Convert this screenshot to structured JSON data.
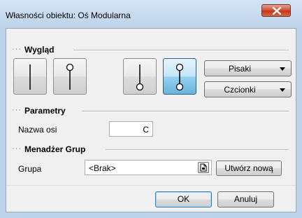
{
  "window": {
    "title": "Własności obiektu: Oś Modularna"
  },
  "sections": {
    "appearance": {
      "title": "Wygląd"
    },
    "parameters": {
      "title": "Parametry"
    },
    "group_manager": {
      "title": "Menadżer Grup"
    }
  },
  "appearance": {
    "axis_styles": [
      {
        "name": "plain-line",
        "selected": false
      },
      {
        "name": "circle-top",
        "selected": false
      },
      {
        "name": "circle-bottom",
        "selected": false
      },
      {
        "name": "circle-both",
        "selected": true
      }
    ],
    "pens_label": "Pisaki",
    "fonts_label": "Czcionki"
  },
  "parameters": {
    "axis_name_label": "Nazwa osi",
    "axis_name_value": "C"
  },
  "group": {
    "label": "Grupa",
    "value": "<Brak>",
    "create_new_label": "Utwórz nową"
  },
  "buttons": {
    "ok": "OK",
    "cancel": "Anuluj"
  },
  "colors": {
    "selected_button": "#68b3db",
    "close_button": "#c4371c",
    "titlebar": "#bed3ea"
  },
  "icons": {
    "close": "close-icon",
    "browse": "document-icon",
    "dropdown": "chevron-down-icon"
  }
}
